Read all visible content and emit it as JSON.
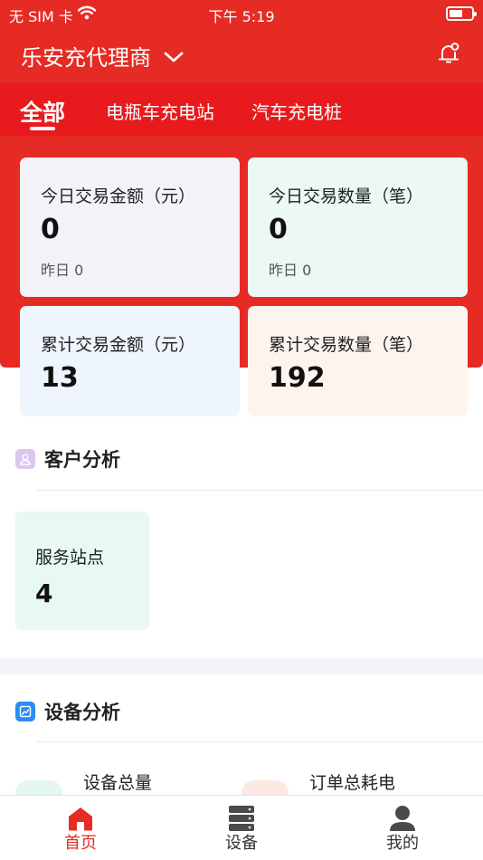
{
  "status_bar": {
    "carrier": "无 SIM 卡",
    "time": "下午 5:19",
    "battery_level": 0.6
  },
  "header": {
    "title": "乐安充代理商"
  },
  "tabs": [
    {
      "label": "全部",
      "active": true
    },
    {
      "label": "电瓶车充电站",
      "active": false
    },
    {
      "label": "汽车充电桩",
      "active": false
    }
  ],
  "stats": {
    "today_amount": {
      "label": "今日交易金额（元）",
      "value": "0",
      "sub": "昨日 0"
    },
    "today_count": {
      "label": "今日交易数量（笔）",
      "value": "0",
      "sub": "昨日 0"
    },
    "total_amount": {
      "label": "累计交易金额（元）",
      "value": "13"
    },
    "total_count": {
      "label": "累计交易数量（笔）",
      "value": "192"
    }
  },
  "customer_section": {
    "title": "客户分析",
    "service_sites": {
      "label": "服务站点",
      "value": "4"
    }
  },
  "device_section": {
    "title": "设备分析",
    "items": [
      {
        "label": "设备总量"
      },
      {
        "label": "订单总耗电"
      }
    ]
  },
  "bottom_nav": [
    {
      "label": "首页",
      "active": true
    },
    {
      "label": "设备",
      "active": false
    },
    {
      "label": "我的",
      "active": false
    }
  ],
  "colors": {
    "brand_red": "#e52b24",
    "active_nav": "#e52b24",
    "card_today_amount": "#f4f2f9",
    "card_today_count": "#ebf8f4",
    "card_total_amount": "#eef5fd",
    "card_total_count": "#fdf4ee",
    "card_service_sites": "#e7f9f2"
  },
  "icons": {
    "wifi": "wifi-icon",
    "battery": "battery-icon",
    "dropdown": "chevron-down-icon",
    "notification": "bell-icon",
    "customer": "user-icon",
    "device": "chart-icon",
    "device_total": "device-grid-icon",
    "order_power": "power-icon",
    "home": "home-icon",
    "equipment": "server-icon",
    "profile": "person-icon"
  }
}
